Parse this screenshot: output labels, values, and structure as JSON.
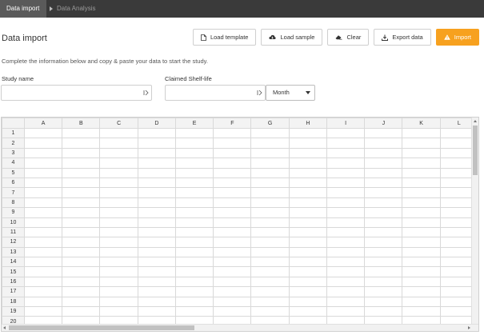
{
  "nav": {
    "active_tab": "Data import",
    "next_tab": "Data Analysis"
  },
  "page": {
    "title": "Data import",
    "intro": "Complete the information below and copy & paste your data to start the study."
  },
  "toolbar": {
    "load_template": "Load template",
    "load_sample": "Load sample",
    "clear": "Clear",
    "export_data": "Export data",
    "import": "Import",
    "icons": [
      "file-icon",
      "cloud-download-icon",
      "eraser-icon",
      "download-icon",
      "warning-icon"
    ],
    "primary_color": "#f7a11f"
  },
  "form": {
    "study_name_label": "Study name",
    "study_name_value": "",
    "shelf_life_label": "Claimed Shelf-life",
    "shelf_life_value": "",
    "unit_selected": "Month"
  },
  "sheet": {
    "columns": [
      "A",
      "B",
      "C",
      "D",
      "E",
      "F",
      "G",
      "H",
      "I",
      "J",
      "K",
      "L"
    ],
    "rows": [
      "1",
      "2",
      "3",
      "4",
      "5",
      "6",
      "7",
      "8",
      "9",
      "10",
      "11",
      "12",
      "13",
      "14",
      "15",
      "16",
      "17",
      "18",
      "19",
      "20"
    ]
  }
}
